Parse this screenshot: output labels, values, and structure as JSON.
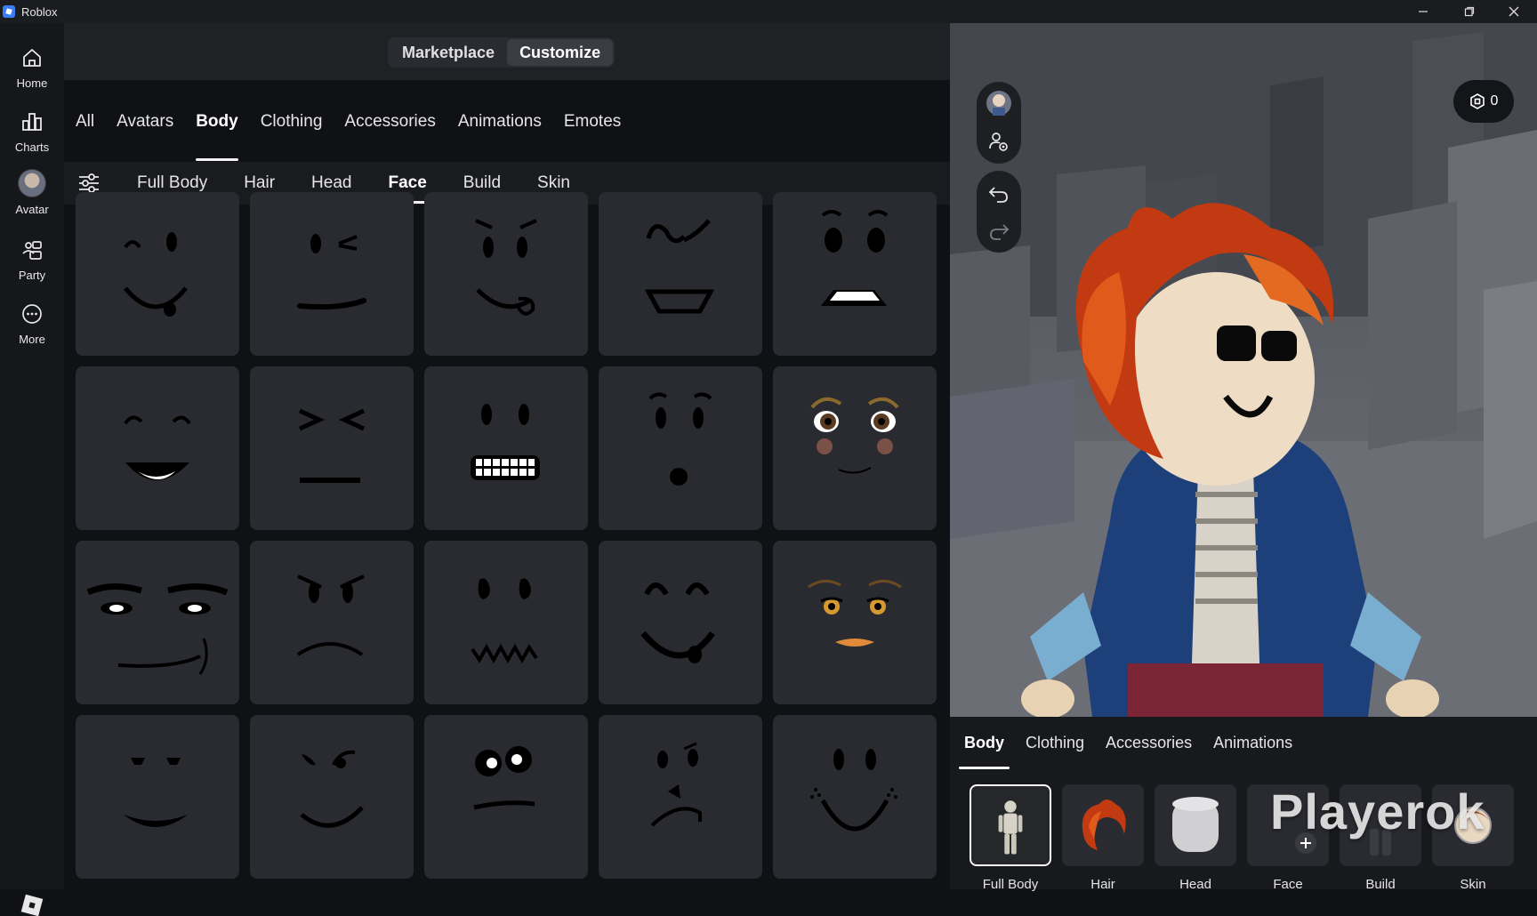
{
  "window": {
    "title": "Roblox"
  },
  "nav": {
    "items": [
      {
        "label": "Home",
        "icon": "home-icon"
      },
      {
        "label": "Charts",
        "icon": "charts-icon"
      },
      {
        "label": "Avatar",
        "icon": "avatar-thumbnail"
      },
      {
        "label": "Party",
        "icon": "party-icon"
      },
      {
        "label": "More",
        "icon": "more-icon"
      }
    ]
  },
  "segmented": {
    "marketplace": "Marketplace",
    "customize": "Customize",
    "active": "Customize"
  },
  "category_tabs": [
    "All",
    "Avatars",
    "Body",
    "Clothing",
    "Accessories",
    "Animations",
    "Emotes"
  ],
  "category_active": "Body",
  "subcategory_tabs": [
    "Full Body",
    "Hair",
    "Head",
    "Face",
    "Build",
    "Skin"
  ],
  "subcategory_active": "Face",
  "robux": {
    "balance": "0"
  },
  "bottom_tabs": [
    "Body",
    "Clothing",
    "Accessories",
    "Animations"
  ],
  "bottom_active": "Body",
  "slots": [
    {
      "label": "Full Body",
      "icon": "full-body-figure"
    },
    {
      "label": "Hair",
      "icon": "hair-thumbnail"
    },
    {
      "label": "Head",
      "icon": "head-thumbnail"
    },
    {
      "label": "Face",
      "icon": "add-icon"
    },
    {
      "label": "Build",
      "icon": "build-thumbnail"
    },
    {
      "label": "Skin",
      "icon": "skin-swatch"
    }
  ],
  "watermark": "Playerok",
  "colors": {
    "accent_underline": "#f2f2f2",
    "tile_bg": "#2a2b30",
    "panel_bg": "#18191c"
  }
}
